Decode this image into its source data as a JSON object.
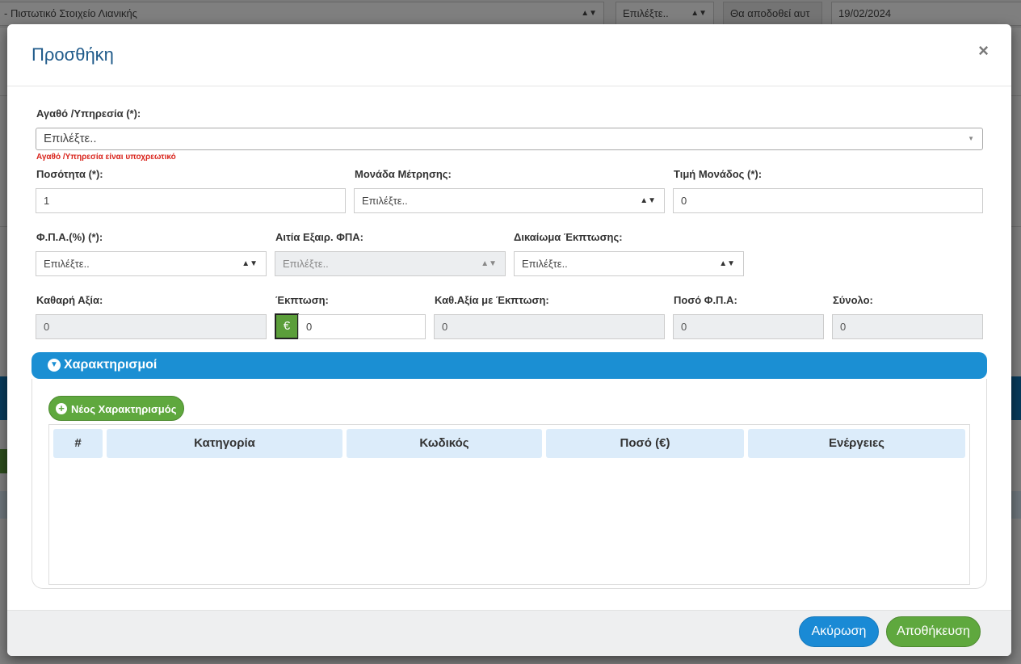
{
  "background": {
    "doc_type": "- Πιστωτικό Στοιχείο Λιανικής",
    "select_placeholder": "Επιλέξτε..",
    "delivery_placeholder": "Θα αποδοθεί αυτ",
    "date": "19/02/2024"
  },
  "modal": {
    "title": "Προσθήκη",
    "close": "×"
  },
  "form": {
    "product": {
      "label": "Αγαθό /Υπηρεσία (*):",
      "value": "Επιλέξτε..",
      "error": "Αγαθό /Υπηρεσία είναι υποχρεωτικό"
    },
    "quantity": {
      "label": "Ποσότητα (*):",
      "value": "1"
    },
    "unit": {
      "label": "Μονάδα Μέτρησης:",
      "value": "Επιλέξτε.."
    },
    "unit_price": {
      "label": "Τιμή Μονάδος (*):",
      "value": "0"
    },
    "vat": {
      "label": "Φ.Π.Α.(%) (*):",
      "value": "Επιλέξτε.."
    },
    "vat_exemption": {
      "label": "Αιτία Εξαιρ. ΦΠΑ:",
      "value": "Επιλέξτε.."
    },
    "deduction_right": {
      "label": "Δικαίωμα Έκπτωσης:",
      "value": "Επιλέξτε.."
    },
    "net_value": {
      "label": "Καθαρή Αξία:",
      "value": "0"
    },
    "discount": {
      "label": "Έκπτωση:",
      "currency": "€",
      "value": "0"
    },
    "net_after_discount": {
      "label": "Καθ.Αξία με Έκπτωση:",
      "value": "0"
    },
    "vat_amount": {
      "label": "Ποσό Φ.Π.Α:",
      "value": "0"
    },
    "total": {
      "label": "Σύνολο:",
      "value": "0"
    }
  },
  "classifications": {
    "title": "Χαρακτηρισμοί",
    "new_button": "Νέος Χαρακτηρισμός",
    "columns": [
      "#",
      "Κατηγορία",
      "Κωδικός",
      "Ποσό (€)",
      "Ενέργειες"
    ],
    "rows": []
  },
  "footer": {
    "cancel": "Ακύρωση",
    "save": "Αποθήκευση"
  },
  "colors": {
    "primary": "#1b8fd3",
    "success": "#5fa83e",
    "error": "#d9251d",
    "title": "#1f5a8a",
    "table_header": "#dcecfa"
  }
}
